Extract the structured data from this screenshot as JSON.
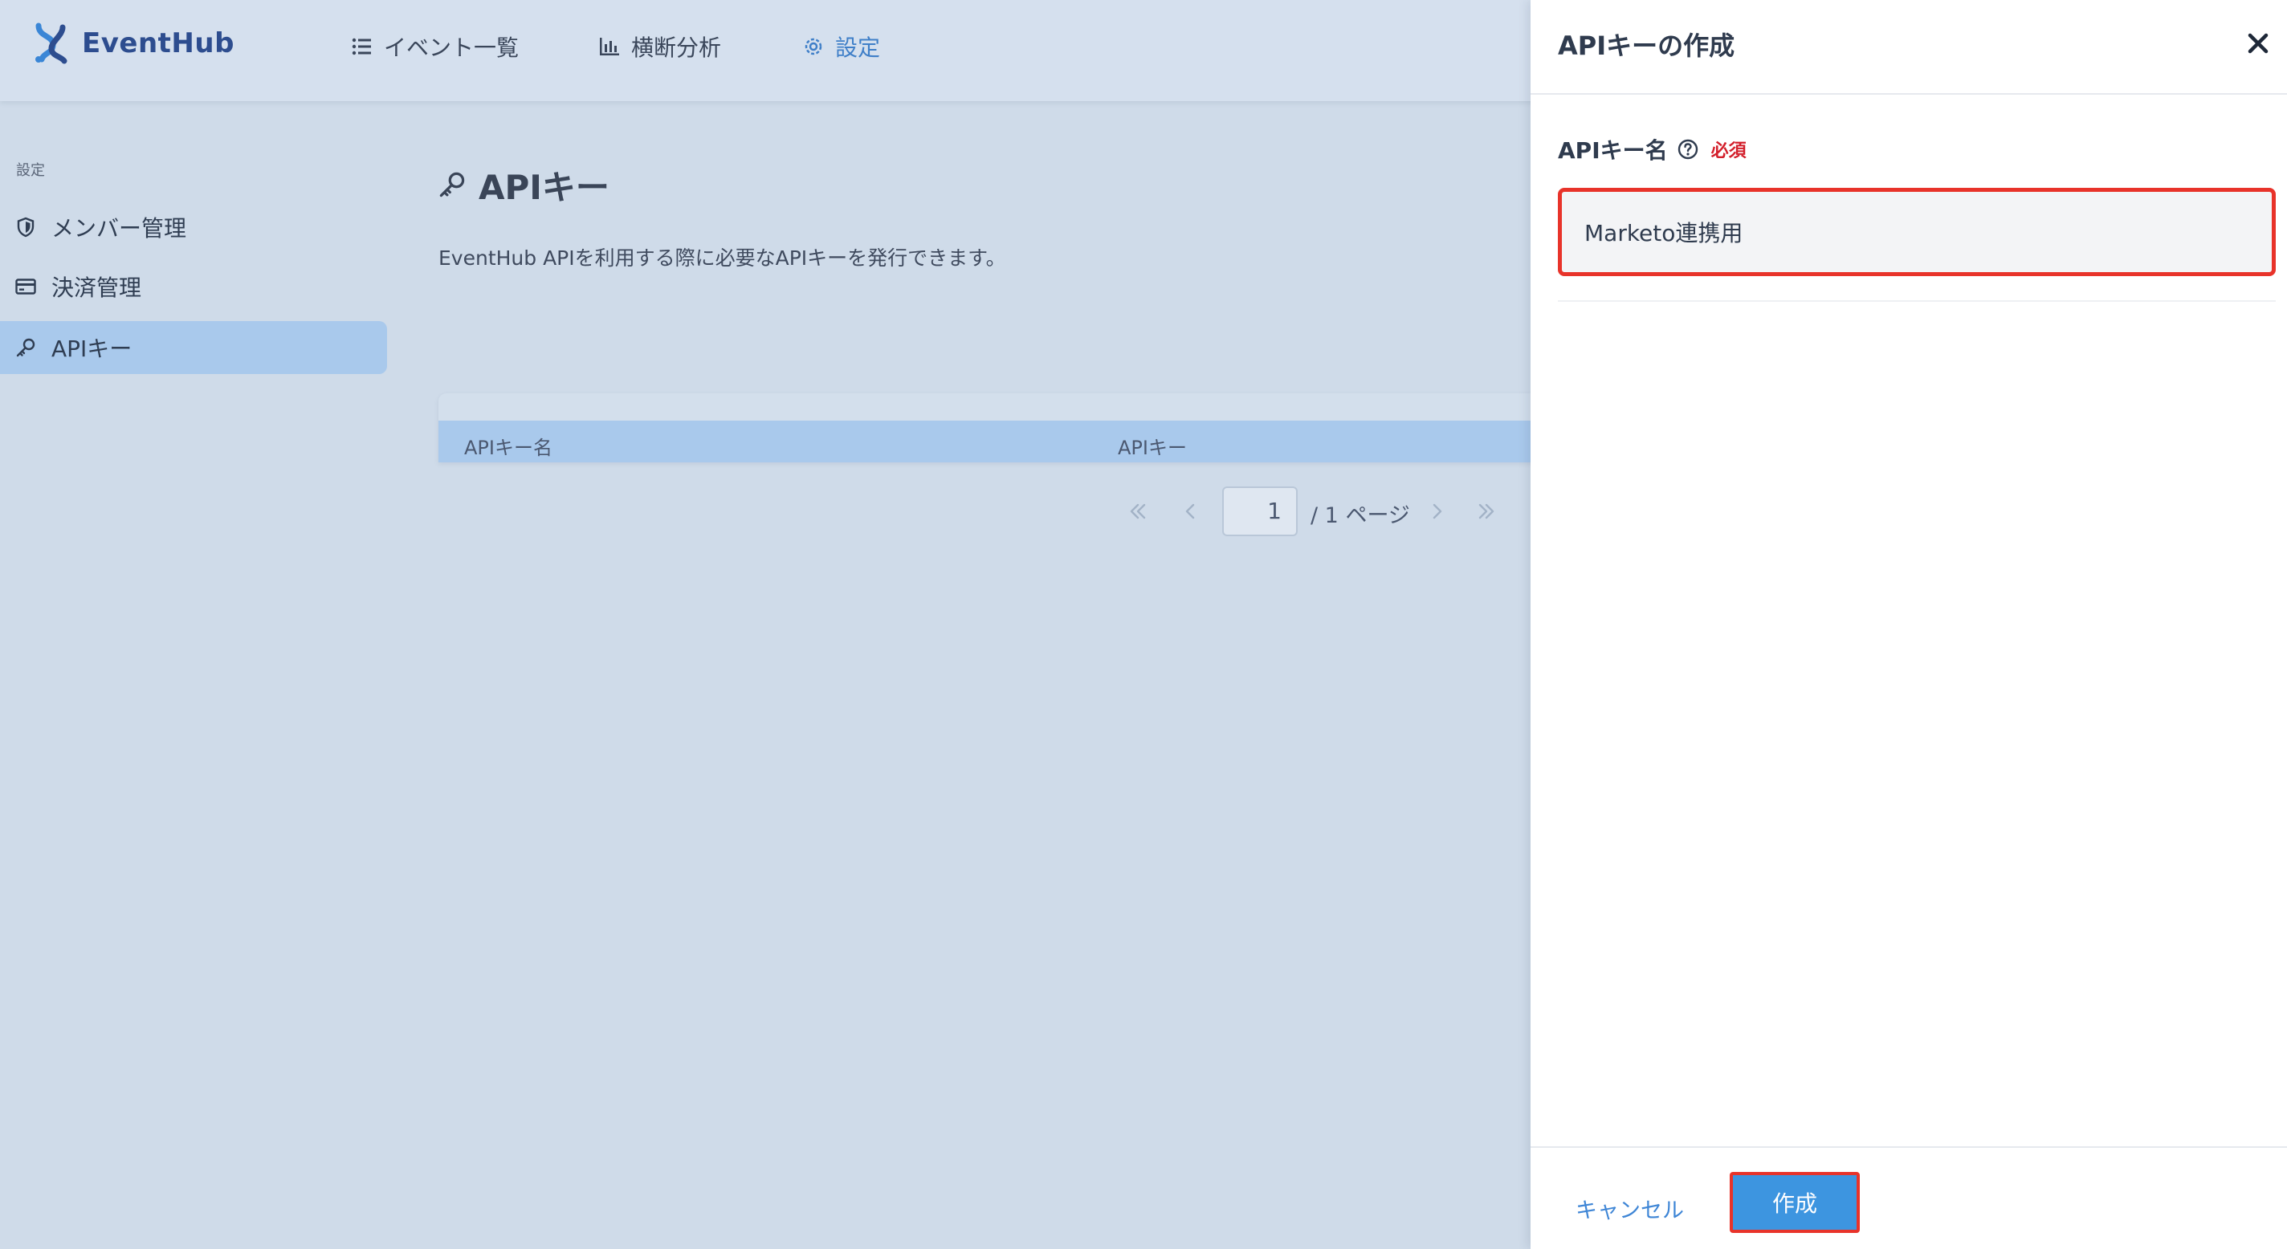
{
  "header": {
    "brand": "EventHub",
    "nav": [
      {
        "label": "イベント一覧",
        "icon": "list-icon"
      },
      {
        "label": "横断分析",
        "icon": "bar-chart-icon"
      },
      {
        "label": "設定",
        "icon": "gear-icon",
        "active": true
      }
    ]
  },
  "sidebar": {
    "section_label": "設定",
    "items": [
      {
        "label": "メンバー管理",
        "icon": "shield-icon"
      },
      {
        "label": "決済管理",
        "icon": "credit-card-icon"
      },
      {
        "label": "APIキー",
        "icon": "key-icon",
        "active": true
      }
    ]
  },
  "main": {
    "title": "APIキー",
    "description": "EventHub APIを利用する際に必要なAPIキーを発行できます。",
    "table": {
      "columns": [
        "APIキー名",
        "APIキー"
      ]
    },
    "pagination": {
      "current_page": "1",
      "total_label": "/ 1 ページ"
    }
  },
  "drawer": {
    "title": "APIキーの作成",
    "field_label": "APIキー名",
    "required_label": "必須",
    "field_value": "Marketo連携用",
    "cancel_label": "キャンセル",
    "create_label": "作成"
  },
  "colors": {
    "accent": "#3d95e0",
    "highlight_border": "#e8332a",
    "required": "#d31f2b",
    "active_bg": "#a9c9ec"
  }
}
